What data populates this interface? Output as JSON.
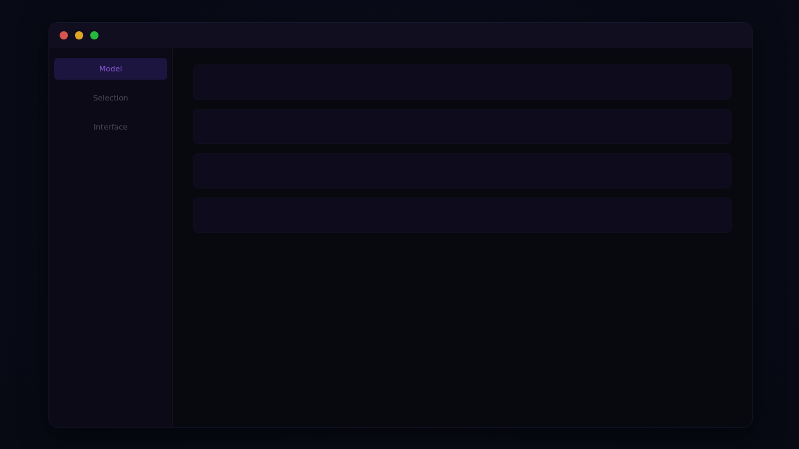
{
  "sidebar": {
    "items": [
      {
        "label": "Model",
        "selected": true
      },
      {
        "label": "Selection",
        "selected": false
      },
      {
        "label": "Interface",
        "selected": false
      }
    ]
  },
  "panels": [
    {
      "kind": "empty"
    },
    {
      "kind": "empty"
    },
    {
      "kind": "empty"
    },
    {
      "kind": "empty"
    }
  ]
}
